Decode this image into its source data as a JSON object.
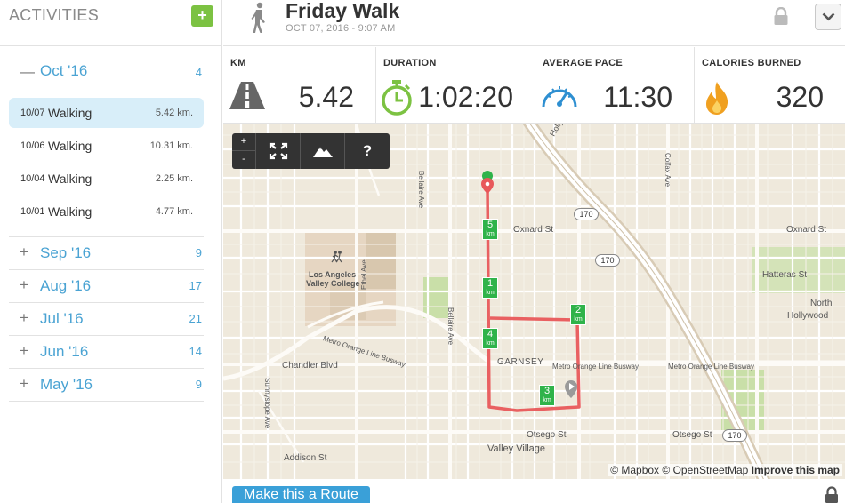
{
  "sidebar": {
    "title": "ACTIVITIES",
    "add_label": "+",
    "open_month": {
      "sign": "—",
      "label": "Oct '16",
      "count": "4"
    },
    "activities": [
      {
        "date": "10/07",
        "type": "Walking",
        "distance": "5.42 km."
      },
      {
        "date": "10/06",
        "type": "Walking",
        "distance": "10.31 km."
      },
      {
        "date": "10/04",
        "type": "Walking",
        "distance": "2.25 km."
      },
      {
        "date": "10/01",
        "type": "Walking",
        "distance": "4.77 km."
      }
    ],
    "months": [
      {
        "sign": "+",
        "label": "Sep '16",
        "count": "9"
      },
      {
        "sign": "+",
        "label": "Aug '16",
        "count": "17"
      },
      {
        "sign": "+",
        "label": "Jul '16",
        "count": "21"
      },
      {
        "sign": "+",
        "label": "Jun '16",
        "count": "14"
      },
      {
        "sign": "+",
        "label": "May '16",
        "count": "9"
      }
    ]
  },
  "header": {
    "title": "Friday Walk",
    "subtitle": "OCT 07, 2016  -  9:07 AM"
  },
  "stats": {
    "km": {
      "label": "KM",
      "value": "5.42"
    },
    "duration": {
      "label": "DURATION",
      "value": "1:02:20"
    },
    "pace": {
      "label": "AVERAGE PACE",
      "value": "11:30"
    },
    "calories": {
      "label": "CALORIES BURNED",
      "value": "320"
    }
  },
  "map": {
    "controls": {
      "zoom_in": "+",
      "zoom_out": "-",
      "help": "?"
    },
    "labels": {
      "oxnard_st_1": "Oxnard St",
      "oxnard_st_2": "Oxnard St",
      "hatteras_st": "Hatteras St",
      "north": "North",
      "hollywood": "Hollywood",
      "lavc_1": "Los Angeles",
      "lavc_2": "Valley College",
      "garnsey": "GARNSEY",
      "chandler": "Chandler Blvd",
      "busway_1": "Metro Orange Line Busway",
      "busway_2": "Metro Orange Line Busway",
      "busway_3": "Metro Orange Line Busway",
      "otsego_1": "Otsego St",
      "otsego_2": "Otsego St",
      "addison": "Addison St",
      "valley_village": "Valley Village",
      "bellaire_1": "Bellaire Ave",
      "bellaire_2": "Bellaire Ave",
      "ethel": "Ethel Ave",
      "colfax": "Colfax Ave",
      "sunnyslope": "Sunnyslope Ave",
      "hollywood_fwy": "Hollywood Fwy",
      "hw_1": "170",
      "hw_2": "170",
      "hw_3": "170"
    },
    "km_markers": [
      {
        "n": "5",
        "u": "km"
      },
      {
        "n": "1",
        "u": "km"
      },
      {
        "n": "2",
        "u": "km"
      },
      {
        "n": "4",
        "u": "km"
      },
      {
        "n": "3",
        "u": "km"
      }
    ],
    "attribution": {
      "mapbox": "© Mapbox",
      "osm": "© OpenStreetMap",
      "improve": "Improve this map"
    }
  },
  "footer": {
    "route_button": "Make this a Route"
  },
  "colors": {
    "accent_blue": "#3aa0d8",
    "add_green": "#7cc242",
    "route_red": "#e8585a",
    "km_green": "#2fb34a",
    "pace_blue": "#2e8fd1",
    "fire_orange": "#f0a020"
  }
}
